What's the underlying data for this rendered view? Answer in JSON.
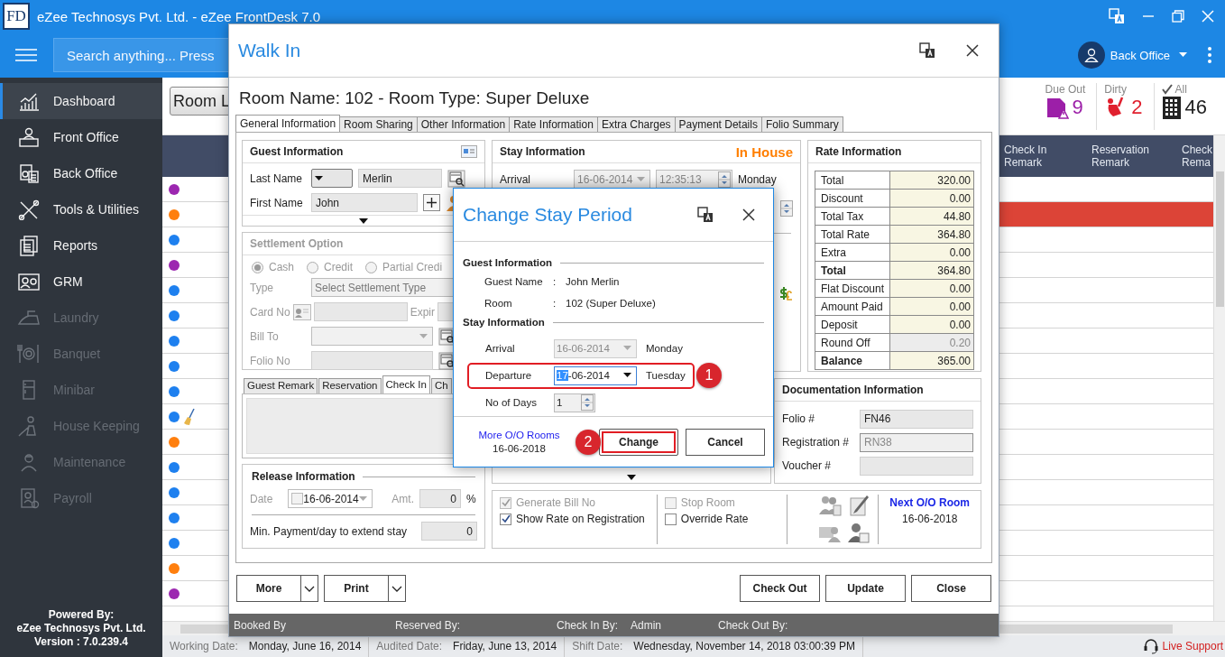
{
  "window": {
    "logo": "FD",
    "title": "eZee Technosys Pvt. Ltd. - eZee FrontDesk 7.0"
  },
  "search": {
    "placeholder": "Search anything... Press"
  },
  "user": {
    "label": "Back Office"
  },
  "sidebar": {
    "items": [
      {
        "label": "Dashboard",
        "selected": true,
        "disabled": false
      },
      {
        "label": "Front Office",
        "selected": false,
        "disabled": false
      },
      {
        "label": "Back Office",
        "selected": false,
        "disabled": false
      },
      {
        "label": "Tools & Utilities",
        "selected": false,
        "disabled": false
      },
      {
        "label": "Reports",
        "selected": false,
        "disabled": false
      },
      {
        "label": "GRM",
        "selected": false,
        "disabled": false
      },
      {
        "label": "Laundry",
        "selected": false,
        "disabled": true
      },
      {
        "label": "Banquet",
        "selected": false,
        "disabled": true
      },
      {
        "label": "Minibar",
        "selected": false,
        "disabled": true
      },
      {
        "label": "House Keeping",
        "selected": false,
        "disabled": true
      },
      {
        "label": "Maintenance",
        "selected": false,
        "disabled": true
      },
      {
        "label": "Payroll",
        "selected": false,
        "disabled": true
      }
    ],
    "footer": {
      "powered": "Powered By:",
      "company": "eZee Technosys Pvt. Ltd.",
      "version": "Version : 7.0.239.4"
    }
  },
  "room_button": {
    "label": "Room L"
  },
  "stats": [
    {
      "label": "Due Out",
      "value": "9",
      "color": "#9c1fa8"
    },
    {
      "label": "Dirty",
      "value": "2",
      "color": "#e0202e"
    },
    {
      "label": "All",
      "value": "46",
      "color": "#222222"
    }
  ],
  "table": {
    "columns": [
      "Check In Remark",
      "Reservation Remark",
      "Check Rema"
    ],
    "rows": [
      {
        "color": "#9c27b0",
        "highlighted": false,
        "broom": false
      },
      {
        "color": "#ff7f0e",
        "highlighted": true,
        "broom": false
      },
      {
        "color": "#1e80ef",
        "highlighted": false,
        "broom": false
      },
      {
        "color": "#9c27b0",
        "highlighted": false,
        "broom": false
      },
      {
        "color": "#1e80ef",
        "highlighted": false,
        "broom": false
      },
      {
        "color": "#1e80ef",
        "highlighted": false,
        "broom": false
      },
      {
        "color": "#1e80ef",
        "highlighted": false,
        "broom": false
      },
      {
        "color": "#1e80ef",
        "highlighted": false,
        "broom": false
      },
      {
        "color": "#1e80ef",
        "highlighted": false,
        "broom": false
      },
      {
        "color": "#1e80ef",
        "highlighted": false,
        "broom": true
      },
      {
        "color": "#ff7f0e",
        "highlighted": false,
        "broom": false
      },
      {
        "color": "#1e80ef",
        "highlighted": false,
        "broom": false
      },
      {
        "color": "#1e80ef",
        "highlighted": false,
        "broom": false
      },
      {
        "color": "#1e80ef",
        "highlighted": false,
        "broom": false
      },
      {
        "color": "#1e80ef",
        "highlighted": false,
        "broom": false
      },
      {
        "color": "#ff7f0e",
        "highlighted": false,
        "broom": false
      },
      {
        "color": "#9c27b0",
        "highlighted": false,
        "broom": false
      }
    ]
  },
  "status_bar": {
    "items": [
      {
        "label": "Working Date:",
        "value": "Monday, June 16, 2014"
      },
      {
        "label": "Audited Date:",
        "value": "Friday, June 13, 2014"
      },
      {
        "label": "Shift Date:",
        "value": "Wednesday, November 14, 2018 03:00:39 PM"
      }
    ],
    "support": "Live Support"
  },
  "walk_in": {
    "title": "Walk In",
    "heading": "Room Name: 102 - Room Type: Super Deluxe",
    "tabs": [
      {
        "label": "General Information",
        "selected": true
      },
      {
        "label": "Room Sharing",
        "selected": false
      },
      {
        "label": "Other Information",
        "selected": false
      },
      {
        "label": "Rate Information",
        "selected": false
      },
      {
        "label": "Extra Charges",
        "selected": false
      },
      {
        "label": "Payment Details",
        "selected": false
      },
      {
        "label": "Folio Summary",
        "selected": false
      }
    ],
    "guest": {
      "title": "Guest Information",
      "last_name_label": "Last Name",
      "last_name": "Merlin",
      "first_name_label": "First Name",
      "first_name": "John"
    },
    "settlement": {
      "title": "Settlement Option",
      "disabled": true,
      "radios": [
        {
          "label": "Cash",
          "selected": true
        },
        {
          "label": "Credit",
          "selected": false
        },
        {
          "label": "Partial Credi",
          "selected": false
        }
      ],
      "type_label": "Type",
      "type_placeholder": "Select Settlement Type",
      "card_label": "Card No",
      "expiry_label": "Expir",
      "bill_label": "Bill To",
      "folio_label": "Folio No"
    },
    "remark_tabs": [
      {
        "label": "Guest Remark",
        "selected": false
      },
      {
        "label": "Reservation",
        "selected": false
      },
      {
        "label": "Check In",
        "selected": true
      },
      {
        "label": "Ch",
        "selected": false
      }
    ],
    "release": {
      "title": "Release Information",
      "date_label": "Date",
      "date_checked": false,
      "date": "16-06-2014",
      "amount_label": "Amt.",
      "amount": "0",
      "percent": "%",
      "min_label": "Min. Payment/day to extend stay",
      "min_value": "0"
    },
    "stay": {
      "title": "Stay Information",
      "status": "In House",
      "arrival_label": "Arrival",
      "arrival_date": "16-06-2014",
      "arrival_time": "12:35:13",
      "arrival_day": "Monday"
    },
    "rate": {
      "title": "Rate Information",
      "rows": [
        {
          "label": "Total",
          "value": "320.00",
          "bold": false,
          "editable": true
        },
        {
          "label": "Discount",
          "value": "0.00",
          "bold": false,
          "editable": true
        },
        {
          "label": "Total Tax",
          "value": "44.80",
          "bold": false,
          "editable": true
        },
        {
          "label": "Total Rate",
          "value": "364.80",
          "bold": false,
          "editable": true
        },
        {
          "label": "Extra",
          "value": "0.00",
          "bold": false,
          "editable": true
        },
        {
          "label": "Total",
          "value": "364.80",
          "bold": true,
          "editable": true
        },
        {
          "label": "Flat Discount",
          "value": "0.00",
          "bold": false,
          "editable": true
        },
        {
          "label": "Amount Paid",
          "value": "0.00",
          "bold": false,
          "editable": true
        },
        {
          "label": "Deposit",
          "value": "0.00",
          "bold": false,
          "editable": true
        },
        {
          "label": "Round Off",
          "value": "0.20",
          "bold": false,
          "editable": false
        },
        {
          "label": "Balance",
          "value": "365.00",
          "bold": true,
          "editable": true
        }
      ]
    },
    "documentation": {
      "title": "Documentation Information",
      "fields": [
        {
          "label": "Folio #",
          "value": "FN46",
          "disabled": false
        },
        {
          "label": "Registration #",
          "value": "RN38",
          "disabled": true
        },
        {
          "label": "Voucher #",
          "disabled": false
        }
      ]
    },
    "option_groups": [
      {
        "options": [
          {
            "label": "Generate Bill No",
            "checked": true,
            "disabled": true
          },
          {
            "label": "Show Rate on Registration",
            "checked": true,
            "disabled": false
          }
        ]
      },
      {
        "options": [
          {
            "label": "Stop Room",
            "checked": false,
            "disabled": true
          },
          {
            "label": "Override Rate",
            "checked": false,
            "disabled": false
          }
        ]
      }
    ],
    "next_room": {
      "link": "Next O/O Room",
      "date": "16-06-2018"
    },
    "split_buttons": [
      {
        "label": "More"
      },
      {
        "label": "Print"
      }
    ],
    "buttons": [
      {
        "label": "Check Out"
      },
      {
        "label": "Update"
      },
      {
        "label": "Close"
      }
    ],
    "info_bar": [
      {
        "label": "Booked By"
      },
      {
        "label": "Reserved By:"
      },
      {
        "label": "Check In By:",
        "value": "Admin"
      },
      {
        "label": "Check Out By:"
      }
    ]
  },
  "change_stay": {
    "title": "Change Stay Period",
    "guest_section": "Guest Information",
    "guest_rows": [
      {
        "label": "Guest Name",
        "colon": ":",
        "value": "John Merlin"
      },
      {
        "label": "Room",
        "colon": ":",
        "value": "102 (Super Deluxe)"
      }
    ],
    "stay_section": "Stay Information",
    "arrival": {
      "label": "Arrival",
      "date": "16-06-2014",
      "day": "Monday"
    },
    "departure": {
      "label": "Departure",
      "date_selected": "17",
      "date_rest": "-06-2014",
      "day": "Tuesday",
      "highlighted": true,
      "callout": "1"
    },
    "days": {
      "label": "No of Days",
      "value": "1"
    },
    "more_link": "More O/O Rooms",
    "more_date": "16-06-2018",
    "buttons": [
      {
        "label": "Change",
        "highlighted": true,
        "callout": "2"
      },
      {
        "label": "Cancel",
        "highlighted": false
      }
    ]
  }
}
